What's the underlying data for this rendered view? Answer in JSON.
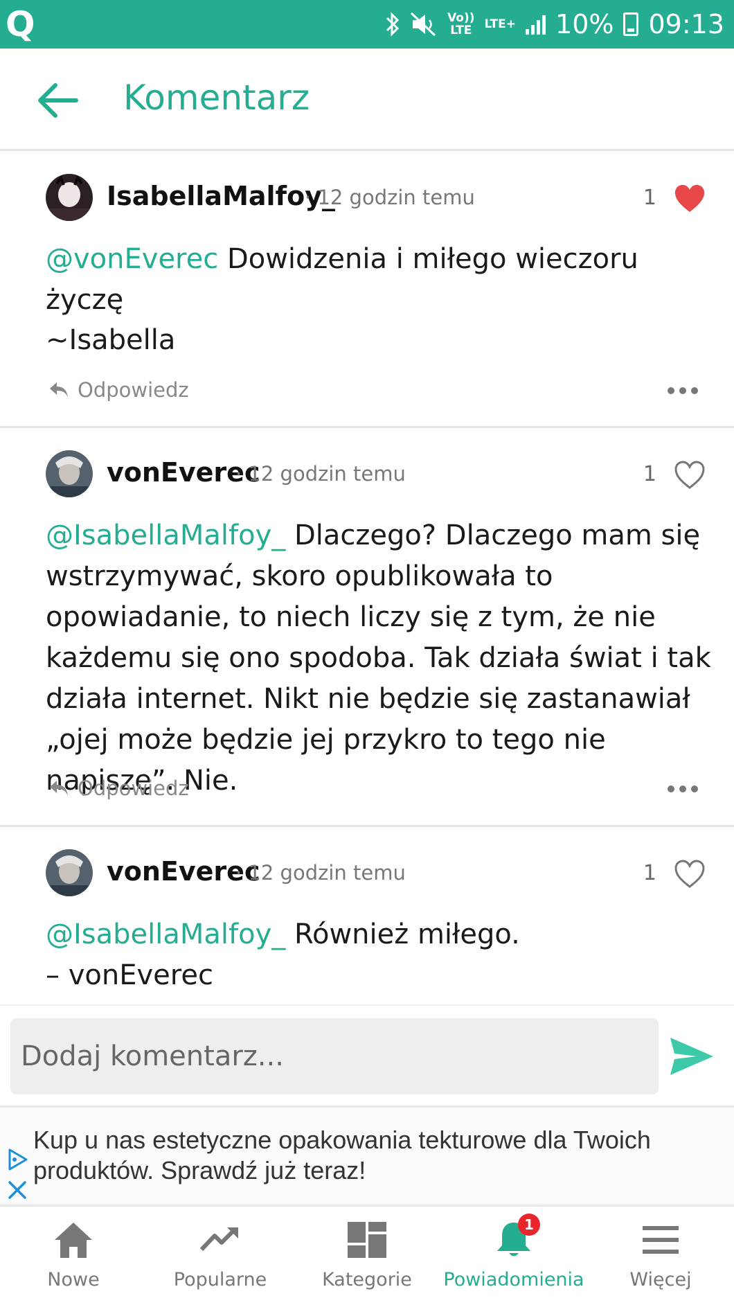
{
  "status_bar": {
    "app_glyph": "Q",
    "volte": "Vo))\nLTE",
    "network": "LTE+",
    "battery_percent": "10%",
    "time": "09:13"
  },
  "header": {
    "title": "Komentarz",
    "back_icon": "arrow-left-icon"
  },
  "colors": {
    "accent": "#25ad92",
    "like_active": "#e8474a",
    "badge": "#e8262b",
    "muted": "#777777"
  },
  "comments": [
    {
      "author": "IsabellaMalfoy_",
      "time": "12 godzin temu",
      "likes": "1",
      "liked": true,
      "mention": "@vonEverec",
      "text": "Dowidzenia i miłego wieczoru życzę",
      "signature": "~Isabella",
      "reply_label": "Odpowiedz"
    },
    {
      "author": "vonEverec",
      "time": "12 godzin temu",
      "likes": "1",
      "liked": false,
      "mention": "@IsabellaMalfoy_",
      "text": "Dlaczego? Dlaczego mam się wstrzymywać, skoro opublikowała to opowiadanie, to niech liczy się z tym, że nie każdemu się ono spodoba. Tak działa świat i tak działa internet. Nikt nie będzie się zastanawiał „ojej może będzie jej przykro to tego nie napiszę”. Nie.",
      "reply_label": "Odpowiedz"
    },
    {
      "author": "vonEverec",
      "time": "12 godzin temu",
      "likes": "1",
      "liked": false,
      "mention": "@IsabellaMalfoy_",
      "text": "Również miłego.",
      "signature": "– vonEverec"
    }
  ],
  "input": {
    "placeholder": "Dodaj komentarz...",
    "value": ""
  },
  "ad": {
    "text": "Kup u nas estetyczne opakowania tekturowe dla Twoich produktów. Sprawdź już teraz!"
  },
  "bottom_nav": [
    {
      "label": "Nowe",
      "icon": "home-icon"
    },
    {
      "label": "Popularne",
      "icon": "trending-icon"
    },
    {
      "label": "Kategorie",
      "icon": "grid-icon"
    },
    {
      "label": "Powiadomienia",
      "icon": "bell-icon",
      "active": true,
      "badge": "1"
    },
    {
      "label": "Więcej",
      "icon": "menu-icon"
    }
  ]
}
